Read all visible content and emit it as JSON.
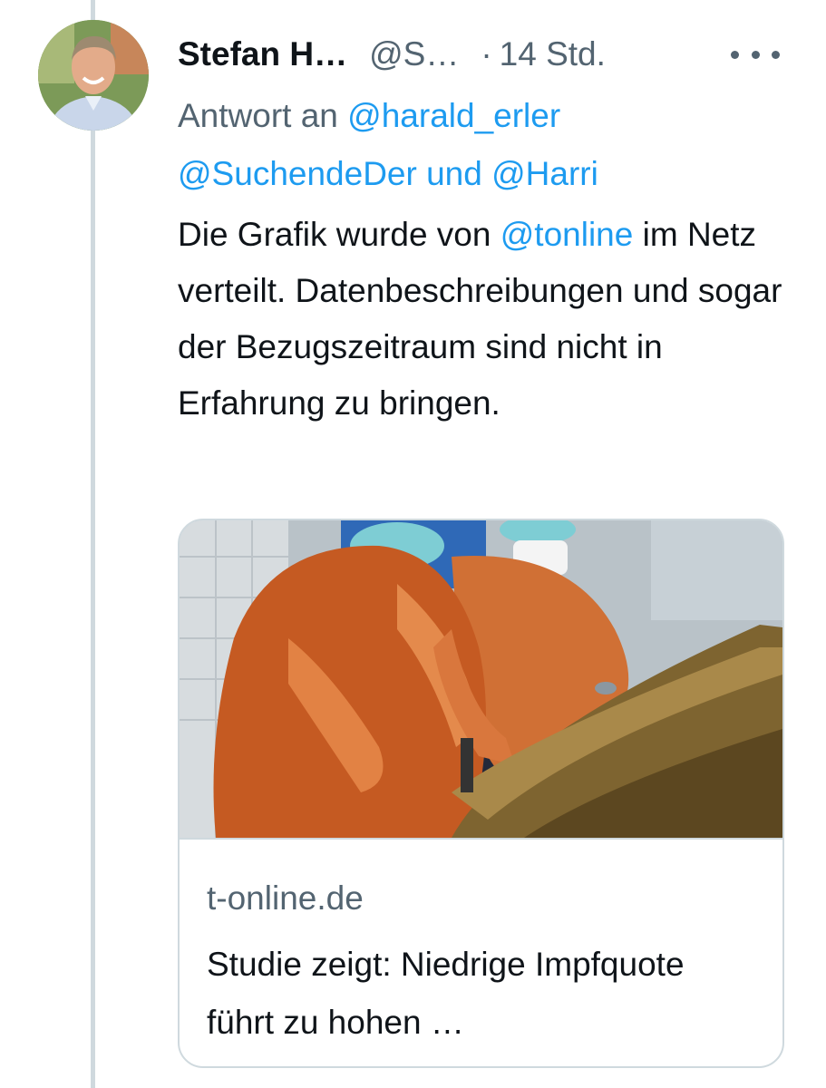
{
  "tweet": {
    "author_name": "Stefan H…",
    "handle": "@S…",
    "separator": "·",
    "time": "14 Std.",
    "reply": {
      "prefix": "Antwort an",
      "mention_1": "@harald_erler",
      "mention_2": "@SuchendeDer",
      "conjunction": "und",
      "mention_3": "@Harri"
    },
    "text": {
      "part_1": "Die Grafik wurde von",
      "mention": "@tonline",
      "part_2": "im Netz verteilt. Datenbeschreibungen und sogar der Bezugszeitraum sind nicht in Erfahrung zu bringen."
    }
  },
  "link_card": {
    "domain": "t-online.de",
    "title": "Studie zeigt: Niedrige Impfquote führt zu hohen …"
  },
  "icons": {
    "more": "more-horizontal-icon",
    "avatar": "profile-photo",
    "card_image": "article-photo"
  },
  "colors": {
    "link_blue": "#1d9bf0",
    "secondary_text": "#536471",
    "primary_text": "#0f1419",
    "border": "#cfd9de"
  }
}
